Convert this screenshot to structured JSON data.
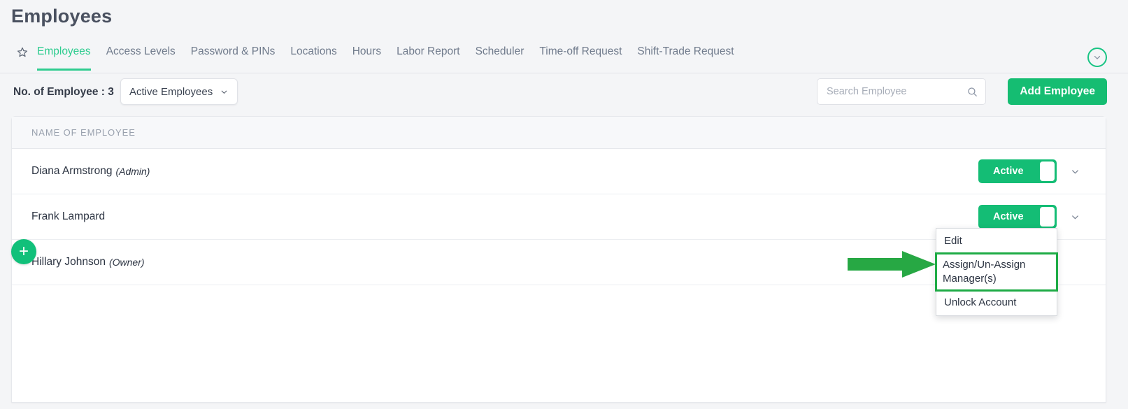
{
  "page": {
    "title": "Employees"
  },
  "tabbar": {
    "favorite_icon": "star-icon",
    "collapse_icon": "chevron-down-icon",
    "tabs": [
      {
        "label": "Employees",
        "active": true
      },
      {
        "label": "Access Levels",
        "active": false
      },
      {
        "label": "Password & PINs",
        "active": false
      },
      {
        "label": "Locations",
        "active": false
      },
      {
        "label": "Hours",
        "active": false
      },
      {
        "label": "Labor Report",
        "active": false
      },
      {
        "label": "Scheduler",
        "active": false
      },
      {
        "label": "Time-off Request",
        "active": false
      },
      {
        "label": "Shift-Trade Request",
        "active": false
      }
    ]
  },
  "filterbar": {
    "employee_count_label": "No. of Employee : 3",
    "status_filter": {
      "selected": "Active Employees",
      "icon": "chevron-down-icon"
    },
    "search": {
      "value": "",
      "placeholder": "Search Employee",
      "icon": "search-icon"
    },
    "add_button": "Add Employee"
  },
  "table": {
    "add_row_button": "+",
    "columns": [
      "NAME OF EMPLOYEE"
    ],
    "rows": [
      {
        "name": "Diana Armstrong",
        "role": "(Admin)",
        "status": "Active",
        "expand_icon": "chevron-down-icon"
      },
      {
        "name": "Frank Lampard",
        "role": "",
        "status": "Active",
        "expand_icon": "chevron-down-icon"
      },
      {
        "name": "Hillary Johnson",
        "role": "(Owner)",
        "status": "",
        "expand_icon": "chevron-down-icon"
      }
    ]
  },
  "context_menu": {
    "items": [
      {
        "label": "Edit",
        "highlighted": false
      },
      {
        "label": "Assign/Un-Assign Manager(s)",
        "highlighted": true
      },
      {
        "label": "Unlock Account",
        "highlighted": false
      }
    ]
  },
  "annotation": {
    "arrow_icon": "right-arrow-annotation",
    "arrow_color": "#27a844",
    "highlight_color": "#1eab45"
  },
  "colors": {
    "brand_green": "#15bd72",
    "tab_active_green": "#2ecc8f",
    "page_background": "#f4f5f7",
    "card_background": "#ffffff",
    "text_primary": "#2c3442",
    "text_muted": "#98a0ad"
  }
}
